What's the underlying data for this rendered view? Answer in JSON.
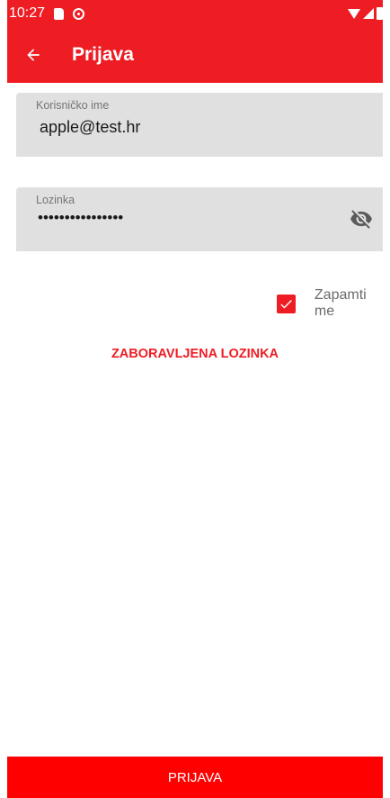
{
  "status_bar": {
    "time": "10:27"
  },
  "app_bar": {
    "title": "Prijava",
    "back_icon": "arrow-back-icon"
  },
  "username_field": {
    "label": "Korisničko ime",
    "value": "apple@test.hr"
  },
  "password_field": {
    "label": "Lozinka",
    "value": "••••••••••••••••",
    "toggle_icon": "eye-off-icon"
  },
  "remember_me": {
    "label": "Zapamti me",
    "checked": true
  },
  "forgot_password": {
    "label": "ZABORAVLJENA LOZINKA"
  },
  "submit": {
    "label": "PRIJAVA"
  },
  "colors": {
    "primary": "#ee1d24",
    "button": "#ff0000",
    "field_bg": "#e0e0e0"
  }
}
